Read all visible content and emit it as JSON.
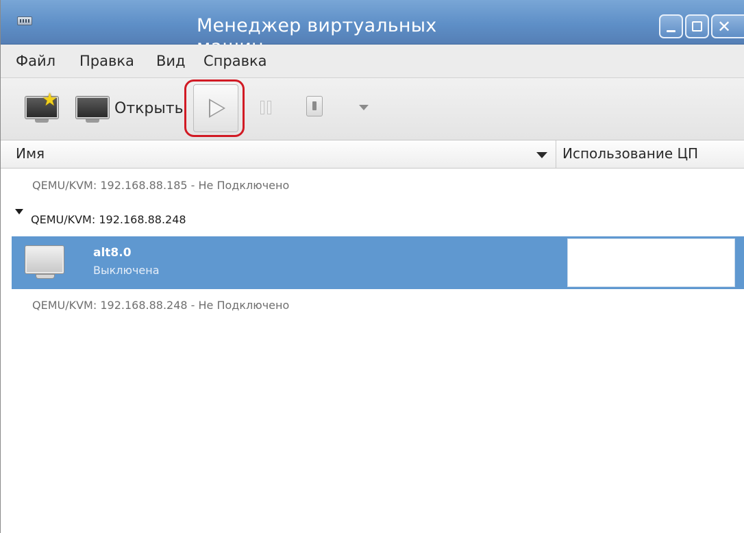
{
  "window": {
    "title": "Менеджер виртуальных машин"
  },
  "menubar": {
    "items": [
      "Файл",
      "Правка",
      "Вид",
      "Справка"
    ]
  },
  "toolbar": {
    "open_label": "Открыть"
  },
  "columns": {
    "name": "Имя",
    "cpu": "Использование ЦП"
  },
  "connections": [
    {
      "label": "QEMU/KVM: 192.168.88.185 - Не Подключено"
    },
    {
      "label": "QEMU/KVM: 192.168.88.248",
      "expanded": true,
      "vms": [
        {
          "name": "alt8.0",
          "status": "Выключена"
        }
      ]
    },
    {
      "label": "QEMU/KVM: 192.168.88.248 - Не Подключено"
    }
  ],
  "colors": {
    "titlebar": "#5e8fc7",
    "selection": "#5f98d0",
    "highlight_ring": "#d11a24"
  },
  "icons": [
    "app-icon",
    "new-vm-icon",
    "open-console-icon",
    "play-icon",
    "pause-icon",
    "shutdown-icon",
    "chevron-down-icon",
    "minimize-icon",
    "maximize-icon",
    "close-icon"
  ]
}
